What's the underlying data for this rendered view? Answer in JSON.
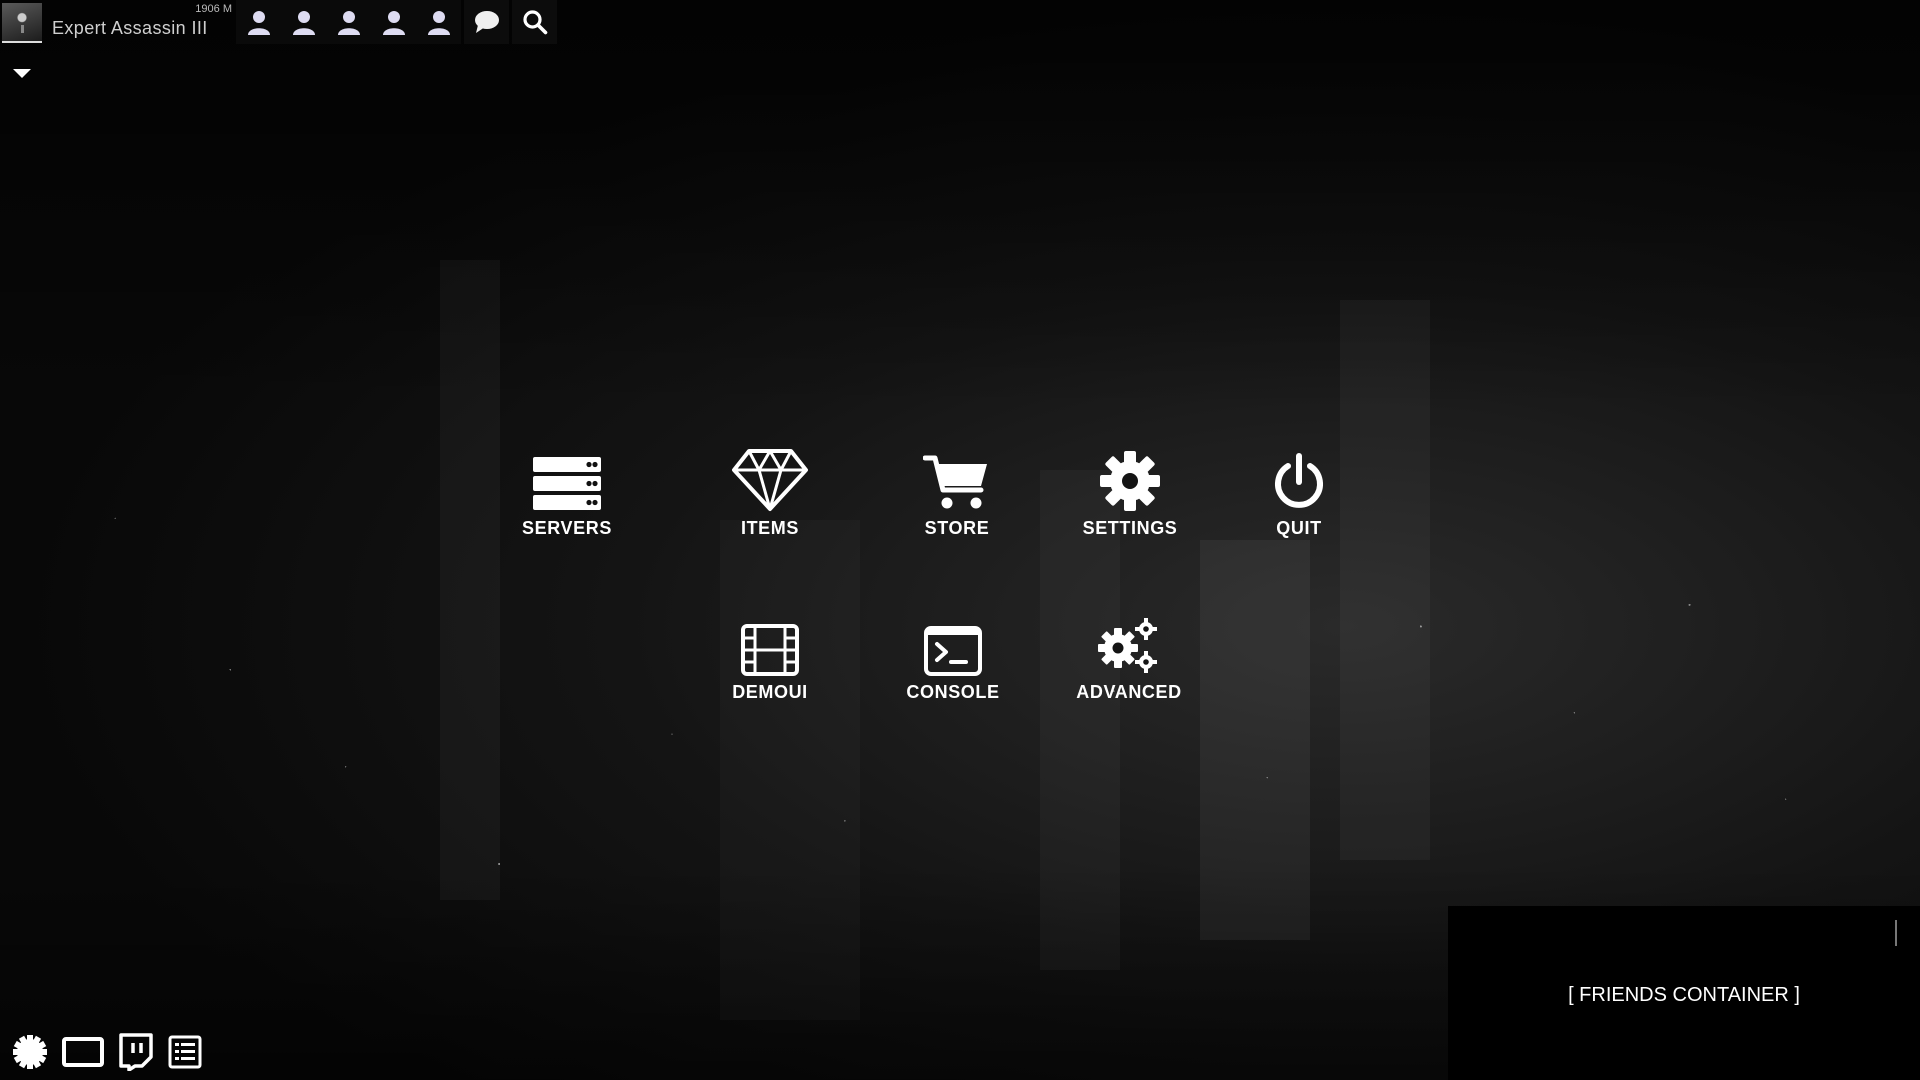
{
  "profile": {
    "elo": "1906 M",
    "rank": "Expert Assassin III"
  },
  "topbar": {
    "icons": [
      "user-icon",
      "user-icon",
      "user-icon",
      "user-icon",
      "user-icon",
      "chat-icon",
      "search-icon"
    ]
  },
  "menu": {
    "servers": "SERVERS",
    "items": "ITEMS",
    "store": "STORE",
    "settings": "SETTINGS",
    "quit": "QUIT",
    "demoui": "DEMOUI",
    "console": "CONSOLE",
    "advanced": "ADVANCED"
  },
  "friends": {
    "label": "[ FRIENDS CONTAINER ]"
  },
  "bottom": {
    "icons": [
      "gear-badge-icon",
      "window-icon",
      "twitch-icon",
      "list-icon"
    ]
  },
  "colors": {
    "background": "#060606",
    "text": "#ffffff",
    "friends_bg": "#000000",
    "top_icon": "#dedcf2"
  }
}
